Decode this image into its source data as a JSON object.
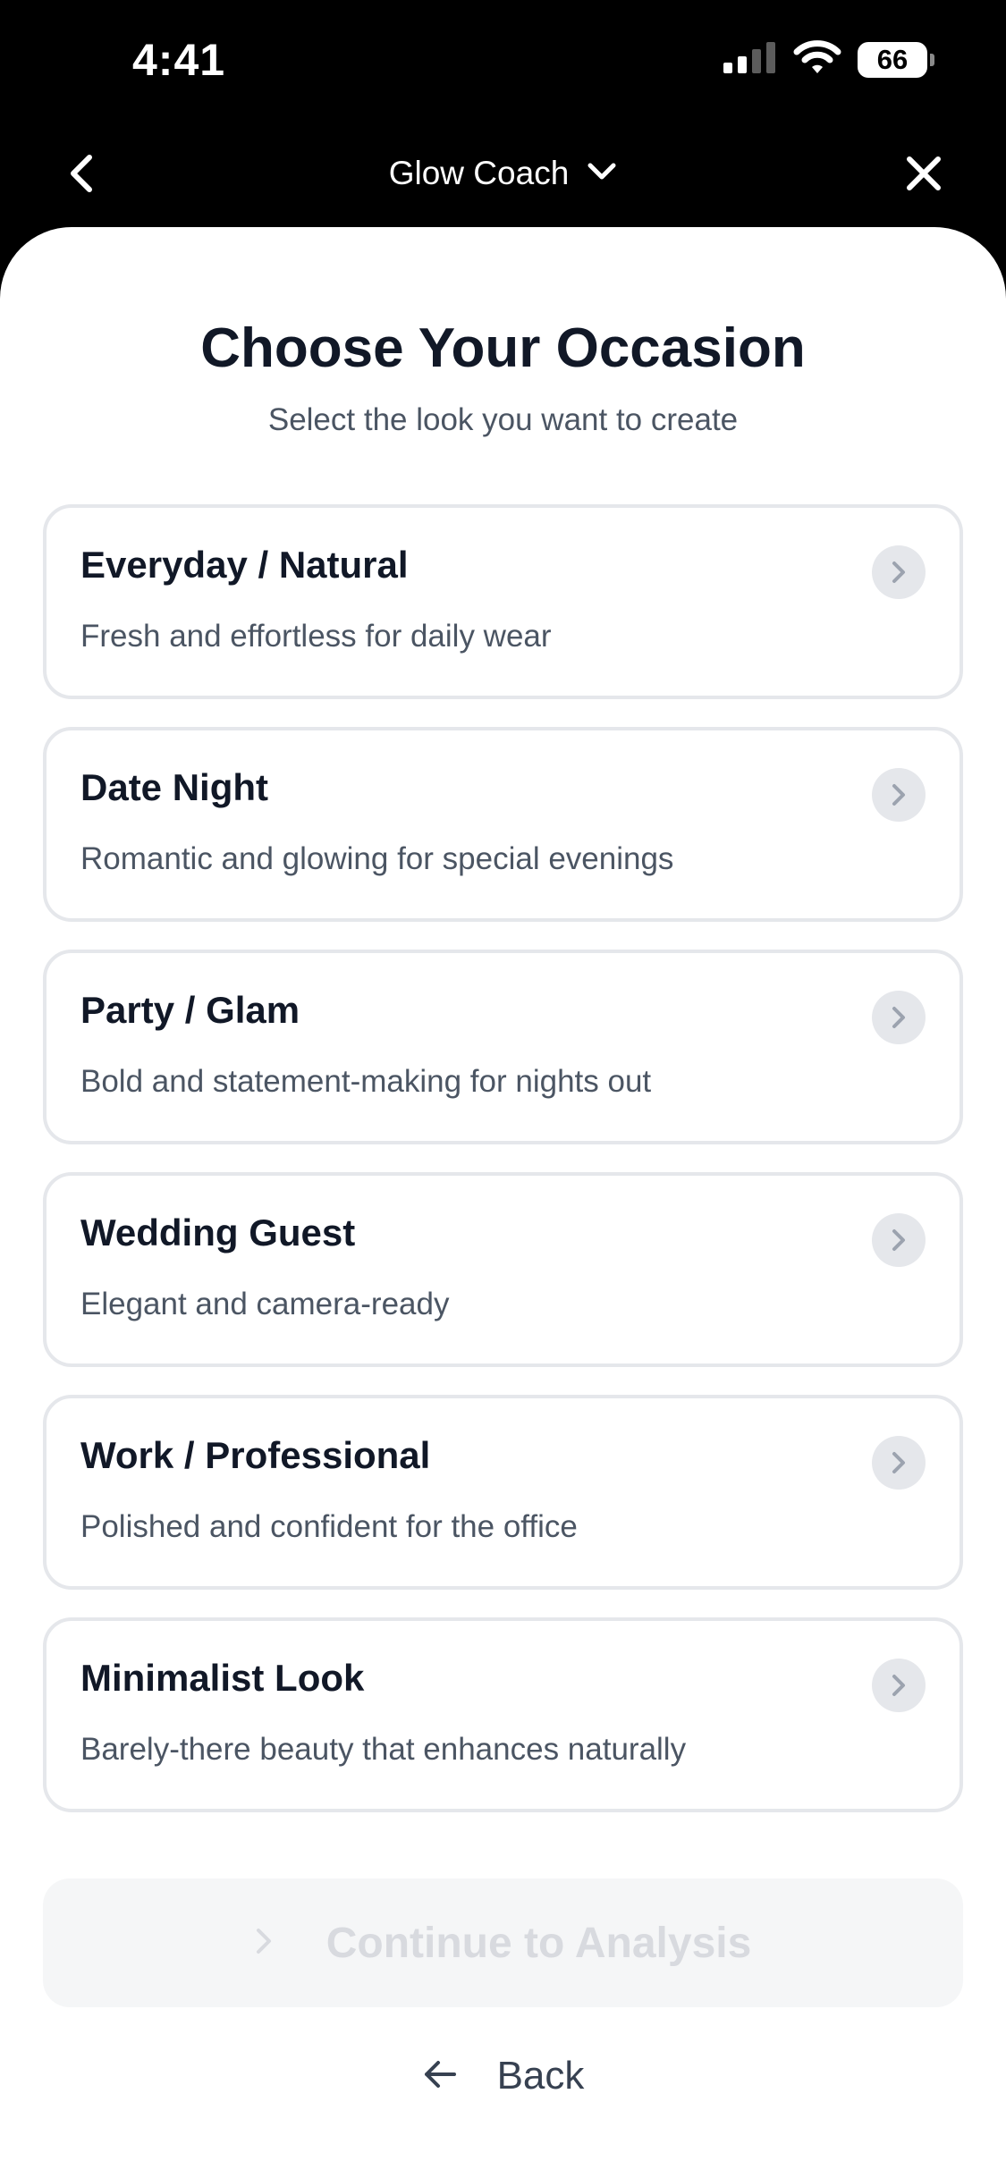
{
  "status_bar": {
    "time": "4:41",
    "battery_level": "66",
    "signal_icon": "cellular-signal-icon",
    "wifi_icon": "wifi-icon"
  },
  "nav": {
    "title": "Glow Coach",
    "back_icon": "chevron-left-icon",
    "dropdown_icon": "chevron-down-icon",
    "close_icon": "close-icon"
  },
  "header": {
    "title": "Choose Your Occasion",
    "subtitle": "Select the look you want to create"
  },
  "occasions": [
    {
      "title": "Everyday / Natural",
      "description": "Fresh and effortless for daily wear"
    },
    {
      "title": "Date Night",
      "description": "Romantic and glowing for special evenings"
    },
    {
      "title": "Party / Glam",
      "description": "Bold and statement-making for nights out"
    },
    {
      "title": "Wedding Guest",
      "description": "Elegant and camera-ready"
    },
    {
      "title": "Work / Professional",
      "description": "Polished and confident for the office"
    },
    {
      "title": "Minimalist Look",
      "description": "Barely-there beauty that enhances naturally"
    }
  ],
  "actions": {
    "continue_label": "Continue to Analysis",
    "continue_disabled": true,
    "back_label": "Back"
  },
  "colors": {
    "background": "#ffffff",
    "header_bg": "#000000",
    "title_text": "#111827",
    "body_text": "#4b5563",
    "card_border": "#e5e7eb",
    "disabled_button_bg": "#f5f6f7",
    "disabled_button_text": "#d8dadf"
  }
}
